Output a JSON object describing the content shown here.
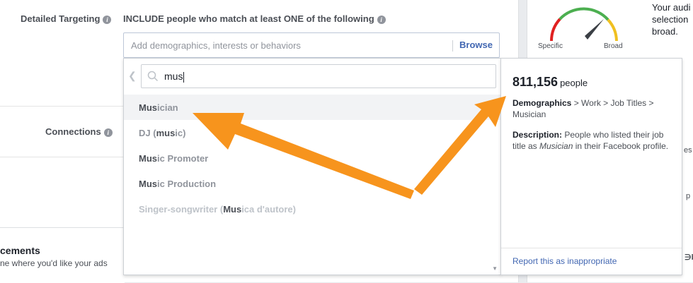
{
  "targeting": {
    "label": "Detailed Targeting",
    "include_text": "INCLUDE people who match at least ONE of the following",
    "input_placeholder": "Add demographics, interests or behaviors",
    "browse_label": "Browse"
  },
  "connections": {
    "label": "Connections"
  },
  "search": {
    "value": "mus"
  },
  "suggestions": [
    {
      "pre": "",
      "match": "Mus",
      "post": "ician"
    },
    {
      "pre": "DJ (",
      "match": "mus",
      "post": "ic)"
    },
    {
      "pre": "",
      "match": "Mus",
      "post": "ic Promoter"
    },
    {
      "pre": "",
      "match": "Mus",
      "post": "ic Production"
    },
    {
      "pre": "Singer-songwriter (",
      "match": "Mus",
      "post": "ica d'autore)"
    }
  ],
  "info_card": {
    "count": "811,156",
    "count_unit": "people",
    "path_bold": "Demographics",
    "path_rest": " > Work > Job Titles > Musician",
    "desc_label": "Description:",
    "desc_pre": " People who listed their job title as ",
    "desc_em": "Musician",
    "desc_post": " in their Facebook profile.",
    "report_link": "Report this as inappropriate"
  },
  "audience": {
    "text": "Your audi selection broad.",
    "gauge_left": "Specific",
    "gauge_right": "Broad",
    "gauge_colors": [
      "#e02020",
      "#f0c020",
      "#4caf50"
    ]
  },
  "placements": {
    "title": "cements",
    "subtitle": "ne where you'd like your ads"
  },
  "edge_fragments": {
    "a": "es",
    "b": "e",
    "c": "p",
    "d": "∋b"
  },
  "colors": {
    "accent": "#4267b2",
    "arrow": "#f7941d"
  }
}
